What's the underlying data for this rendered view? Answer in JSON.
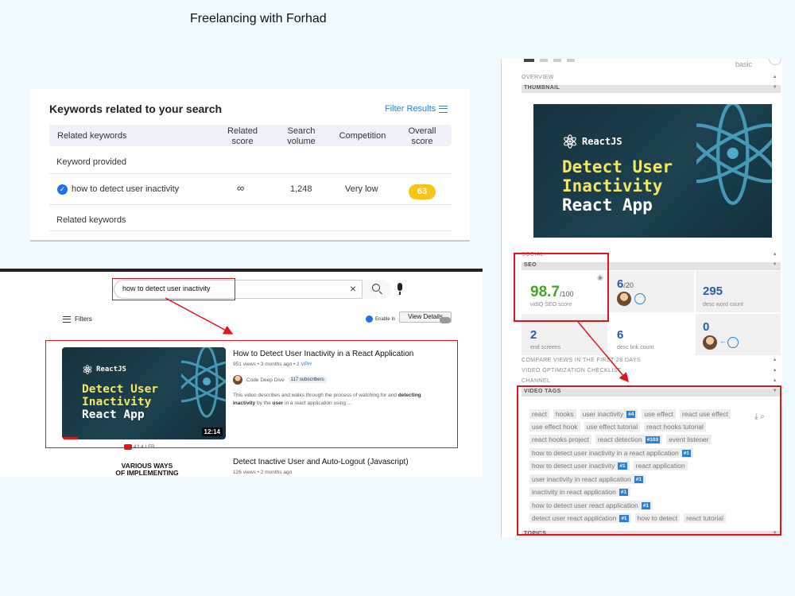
{
  "page_title": "Freelancing with Forhad",
  "keywords_panel": {
    "title": "Keywords related to your search",
    "filter_label": "Filter Results",
    "columns": {
      "related_keywords": "Related keywords",
      "related_score_1": "Related",
      "related_score_2": "score",
      "search_volume_1": "Search",
      "search_volume_2": "volume",
      "competition": "Competition",
      "overall_score_1": "Overall",
      "overall_score_2": "score"
    },
    "section_provided": "Keyword provided",
    "provided_row": {
      "keyword": "how to detect user inactivity",
      "related_score": "∞",
      "search_volume": "1,248",
      "competition": "Very low",
      "overall_score": "63"
    },
    "section_related": "Related keywords"
  },
  "youtube": {
    "search_query": "how to detect user inactivity",
    "clear_icon": "×",
    "filters_label": "Filters",
    "enable_label": "Enable In",
    "view_details_label": "View Details",
    "video1": {
      "thumb_brand": "ReactJS",
      "thumb_line1": "Detect User",
      "thumb_line2": "Inactivity",
      "thumb_line3": "React App",
      "duration": "12:14",
      "title": "How to Detect User Inactivity in a React Application",
      "meta": "951 views • 3 months ago •",
      "vph": "1 VPH",
      "channel": "Code Deep Dive",
      "subscribers": "117 subscribers",
      "desc_1": "This video describes and walks through the process of watching for and ",
      "desc_b1": "detecting inactivity",
      "desc_2": " by the ",
      "desc_b2": "user",
      "desc_3": " in a react application using ...",
      "under_stats": "43   4 LFR"
    },
    "video2": {
      "thumb_text_1": "VARIOUS WAYS",
      "thumb_text_2": "OF IMPLEMENTING",
      "title": "Detect Inactive User and Auto-Logout (Javascript)",
      "meta": "126 views • 2 months ago"
    }
  },
  "vidiq": {
    "logo_text": "basic",
    "sections": {
      "overview": "OVERVIEW",
      "thumbnail": "THUMBNAIL",
      "social": "SOCIAL",
      "seo": "SEO",
      "compare": "COMPARE VIEWS IN THE FIRST 28 DAYS",
      "checklist": "VIDEO OPTIMIZATION CHECKLIST",
      "channel": "CHANNEL",
      "video_tags": "VIDEO TAGS",
      "topics": "TOPICS"
    },
    "seo": {
      "score": "98.7",
      "score_max": "/100",
      "score_label": "vidIQ SEO score",
      "tags_count": "6",
      "tags_max": "/20",
      "desc_words": "295",
      "desc_words_label": "desc word count",
      "end_screens": "2",
      "end_screens_label": "end screens",
      "desc_links": "6",
      "desc_links_label": "desc link count",
      "zero": "0"
    },
    "tags": [
      [
        {
          "t": "react"
        },
        {
          "t": "hooks"
        },
        {
          "t": "user inactivity",
          "r": "#4"
        },
        {
          "t": "use effect"
        },
        {
          "t": "react use effect"
        }
      ],
      [
        {
          "t": "use effect hook"
        },
        {
          "t": "use effect tutorial"
        },
        {
          "t": "react hooks tutorial"
        }
      ],
      [
        {
          "t": "react hooks project"
        },
        {
          "t": "react detection",
          "r": "#103"
        },
        {
          "t": "event listener"
        }
      ],
      [
        {
          "t": "how to detect user inactivity in a react application",
          "r": "#1"
        }
      ],
      [
        {
          "t": "how to detect user inactivity",
          "r": "#1"
        },
        {
          "t": "react application"
        }
      ],
      [
        {
          "t": "user inactivity in react application",
          "r": "#1"
        }
      ],
      [
        {
          "t": "inactivity in react application",
          "r": "#1"
        }
      ],
      [
        {
          "t": "how to detect user react application",
          "r": "#1"
        }
      ],
      [
        {
          "t": "detect user react application",
          "r": "#1"
        },
        {
          "t": "how to detect"
        },
        {
          "t": "react tutorial"
        }
      ]
    ]
  },
  "colors": {
    "accent_red": "#e0141e",
    "brand_blue": "#2a7fd4",
    "seo_green": "#4aa22c",
    "score_yellow": "#f5c518"
  }
}
